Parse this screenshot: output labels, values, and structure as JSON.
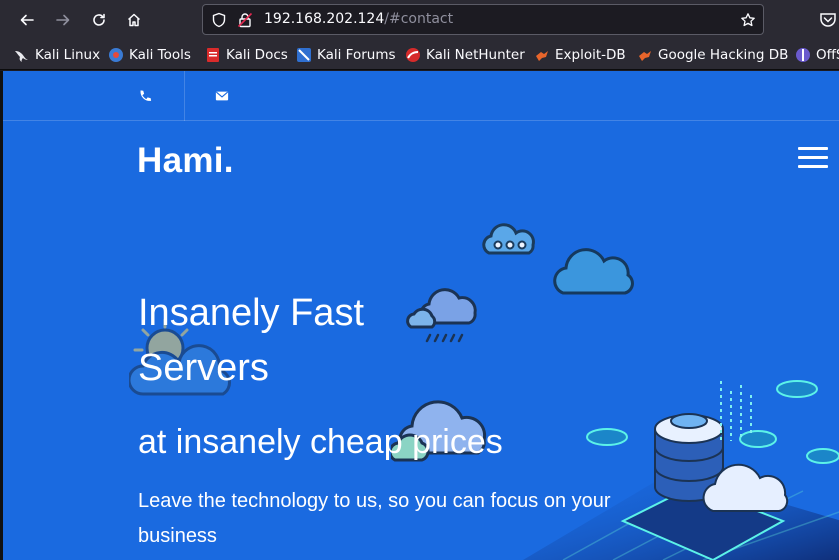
{
  "browser": {
    "url_host": "192.168.202.124",
    "url_path": "/#contact"
  },
  "bookmarks": [
    {
      "label": "Kali Linux",
      "icon": "kali-dragon-icon"
    },
    {
      "label": "Kali Tools",
      "icon": "kali-tools-icon"
    },
    {
      "label": "Kali Docs",
      "icon": "kali-docs-icon"
    },
    {
      "label": "Kali Forums",
      "icon": "kali-forums-icon"
    },
    {
      "label": "Kali NetHunter",
      "icon": "kali-nethunter-icon"
    },
    {
      "label": "Exploit-DB",
      "icon": "exploit-db-icon"
    },
    {
      "label": "Google Hacking DB",
      "icon": "ghdb-icon"
    },
    {
      "label": "OffS",
      "icon": "offsec-icon"
    }
  ],
  "site": {
    "brand": "Hami.",
    "hero_title": "Insanely Fast Servers",
    "hero_subtitle": "at insanely cheap prices",
    "hero_description": "Leave the technology to us, so you can focus on your business"
  },
  "colors": {
    "page_bg": "#1a6ae0",
    "chrome_bg": "#2b2a33"
  }
}
